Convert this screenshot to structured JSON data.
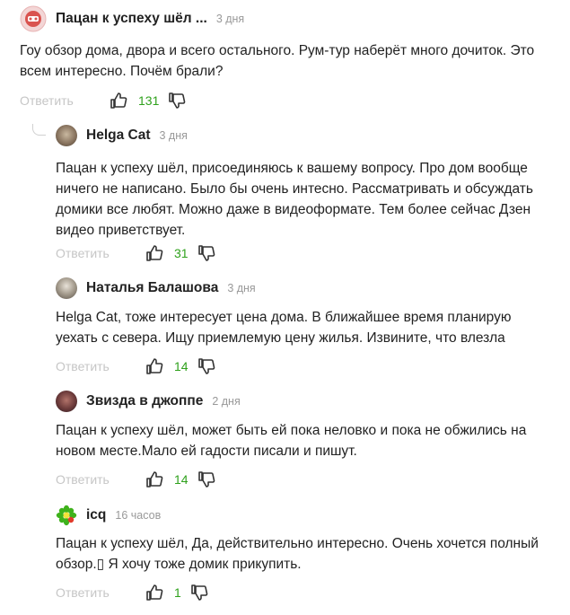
{
  "comments": [
    {
      "author": "Пацан к успеху шёл ...",
      "time": "3 дня",
      "text": "Гоу обзор дома, двора и всего остального. Рум-тур наберёт много дочиток. Это всем интересно. Почём брали?",
      "reply_label": "Ответить",
      "likes": "131"
    },
    {
      "author": "Helga Cat",
      "time": "3 дня",
      "text": "Пацан к успеху шёл, присоединяюсь к вашему вопросу. Про дом вообще ничего не написано. Было бы очень интесно. Рассматривать и обсуждать домики все любят. Можно даже в видеоформате. Тем более сейчас Дзен видео приветствует.",
      "reply_label": "Ответить",
      "likes": "31"
    },
    {
      "author": "Наталья Балашова",
      "time": "3 дня",
      "text": "Helga Cat, тоже интересует цена дома. В ближайшее время планирую уехать с севера. Ищу приемлемую цену жилья. Извините, что влезла",
      "reply_label": "Ответить",
      "likes": "14"
    },
    {
      "author": "Звизда в джоппе",
      "time": "2 дня",
      "text": "Пацан к успеху шёл, может быть ей пока неловко и пока не обжились на новом месте.Мало ей гадости писали и пишут.",
      "reply_label": "Ответить",
      "likes": "14"
    },
    {
      "author": "icq",
      "time": "16 часов",
      "text": "Пацан к успеху шёл, Да, действительно интересно. Очень хочется полный обзор.▯ Я хочу тоже домик прикупить.",
      "reply_label": "Ответить",
      "likes": "1"
    }
  ],
  "colors": {
    "likes": "#2fa11c",
    "muted": "#c6c6c6",
    "time": "#999999"
  },
  "icons": [
    "avatar-mask-icon",
    "like-icon",
    "dislike-icon",
    "icq-flower-icon"
  ]
}
